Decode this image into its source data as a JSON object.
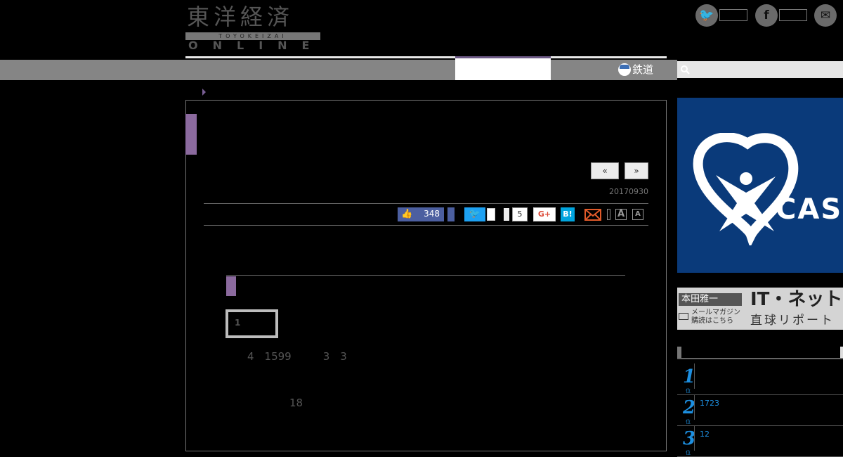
{
  "header": {
    "logo_kanji": "東洋経済",
    "logo_roman": "TOYOKEIZAI",
    "logo_online": "ONLINE"
  },
  "social": {
    "twitter_icon": "twitter-bird-icon",
    "facebook_icon": "facebook-f-icon",
    "messenger_icon": "messenger-icon",
    "twitter_glyph": "🐦",
    "facebook_glyph": "f",
    "messenger_glyph": "✉"
  },
  "nav": {
    "rail_label": "鉄道",
    "search_placeholder": ""
  },
  "article": {
    "prev_label": "«",
    "next_label": "»",
    "date": "20170930",
    "like_count": "348",
    "facebook_share_count": "5",
    "google_plus_label": "G+",
    "hatena_label": "B!",
    "twitter_glyph": "🐦",
    "like_glyph": "👍",
    "font_large_label": "A",
    "font_small_label": "A",
    "lead": "　　　　　　　　　　　　　　　　　　　　　　　　　　　　　　　　　　　　　　　　　　　　　　　　　　　　　",
    "heading": "　　　　　　　　　　　　　　　　",
    "photo_number": "1",
    "paragraphs": [
      "　　4　1599　　　3　3　　　　　　　　　　　　　　　　　　　　　　　　　　　　　　　　　　　　　　　　　　　　　　　　　　　　　　　　　　　　　　　　　　　　　　　　　　　　　　　　　　　　",
      "　　　　　　18　　　　　　　　　　　　　　　　　　　　　　　　　　　　　　　　　　　　　　　　　　　　　　　　　　　　　　　　　　　　　　　　　　　　　　　"
    ]
  },
  "sidebar": {
    "ad_text": "CAS",
    "banner": {
      "author": "本田雅一",
      "title": "IT・ネット",
      "subtitle": "直球リポート",
      "mail_cta": "メールマガジン\n購読はこちら"
    },
    "ranking": [
      {
        "rank": "1",
        "unit": "位",
        "text": ""
      },
      {
        "rank": "2",
        "unit": "位",
        "text": "1723"
      },
      {
        "rank": "3",
        "unit": "位",
        "text": "12"
      }
    ]
  },
  "colors": {
    "accent_purple": "#8b6a9e",
    "facebook_blue": "#4c5fa0",
    "twitter_blue": "#1da1f2",
    "hatena_blue": "#00a4de",
    "rank_blue": "#1d8fe0"
  }
}
